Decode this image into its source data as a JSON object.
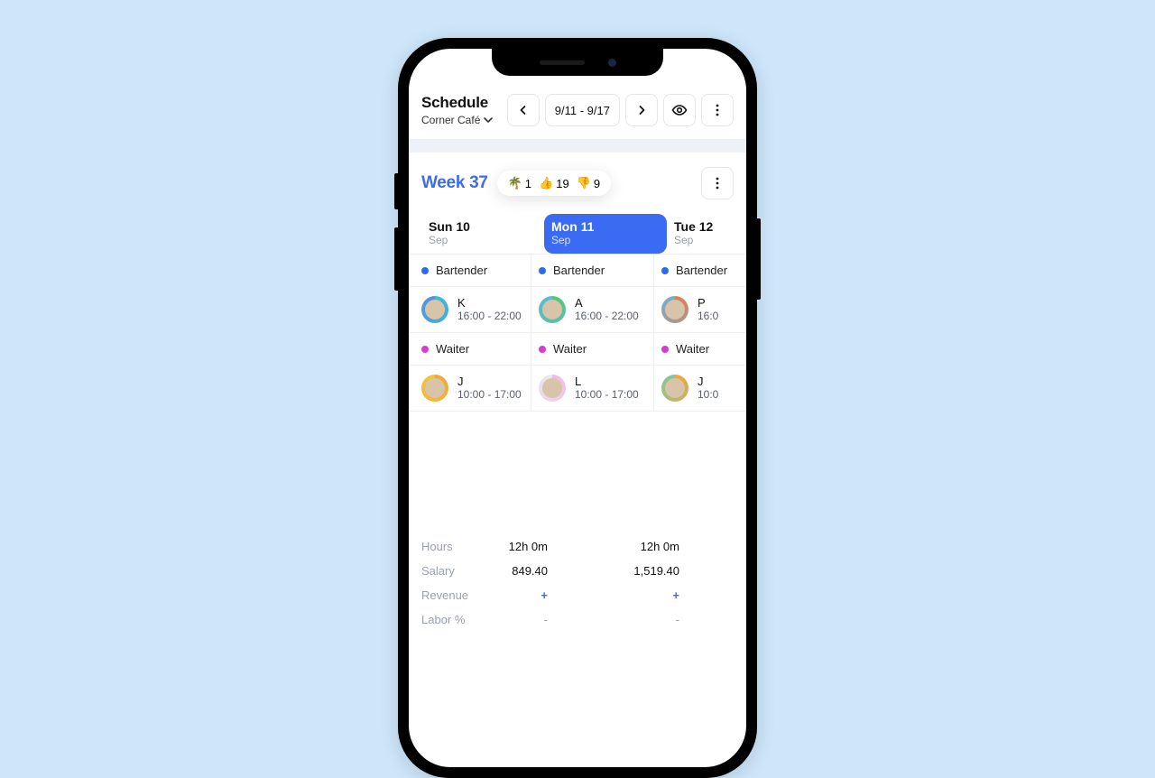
{
  "header": {
    "title": "Schedule",
    "location": "Corner Café",
    "date_range": "9/11 - 9/17"
  },
  "week": {
    "label": "Week 37",
    "stats": {
      "palm": "1",
      "thumbs_up": "19",
      "thumbs_down": "9"
    }
  },
  "days": [
    {
      "label": "Sun 10",
      "month": "Sep",
      "active": false
    },
    {
      "label": "Mon 11",
      "month": "Sep",
      "active": true
    },
    {
      "label": "Tue 12",
      "month": "Sep",
      "active": false
    }
  ],
  "roles": {
    "bartender": "Bartender",
    "waiter": "Waiter"
  },
  "columns": [
    {
      "bartender": {
        "initial": "K",
        "time": "16:00 - 22:00",
        "ring": "#3bbcd6",
        "ring2": "#5a8fe0"
      },
      "waiter": {
        "initial": "J",
        "time": "10:00 - 17:00",
        "ring": "#f2a63b",
        "ring2": "#f2c53b"
      }
    },
    {
      "bartender": {
        "initial": "A",
        "time": "16:00 - 22:00",
        "ring": "#4fc97a",
        "ring2": "#5fb9d9"
      },
      "waiter": {
        "initial": "L",
        "time": "10:00 - 17:00",
        "ring": "#f2b9e2",
        "ring2": "#e9e9f2"
      }
    },
    {
      "bartender": {
        "initial": "P",
        "time": "16:0",
        "ring": "#e07f4f",
        "ring2": "#6fb0d9"
      },
      "waiter": {
        "initial": "J",
        "time": "10:0",
        "ring": "#f2a63b",
        "ring2": "#7fc9a0"
      }
    }
  ],
  "stats": [
    {
      "label": "Hours",
      "v1": "12h 0m",
      "v2": "12h 0m",
      "type": "text"
    },
    {
      "label": "Salary",
      "v1": "849.40",
      "v2": "1,519.40",
      "type": "text"
    },
    {
      "label": "Revenue",
      "v1": "+",
      "v2": "+",
      "type": "plus"
    },
    {
      "label": "Labor %",
      "v1": "-",
      "v2": "-",
      "type": "dash"
    }
  ]
}
